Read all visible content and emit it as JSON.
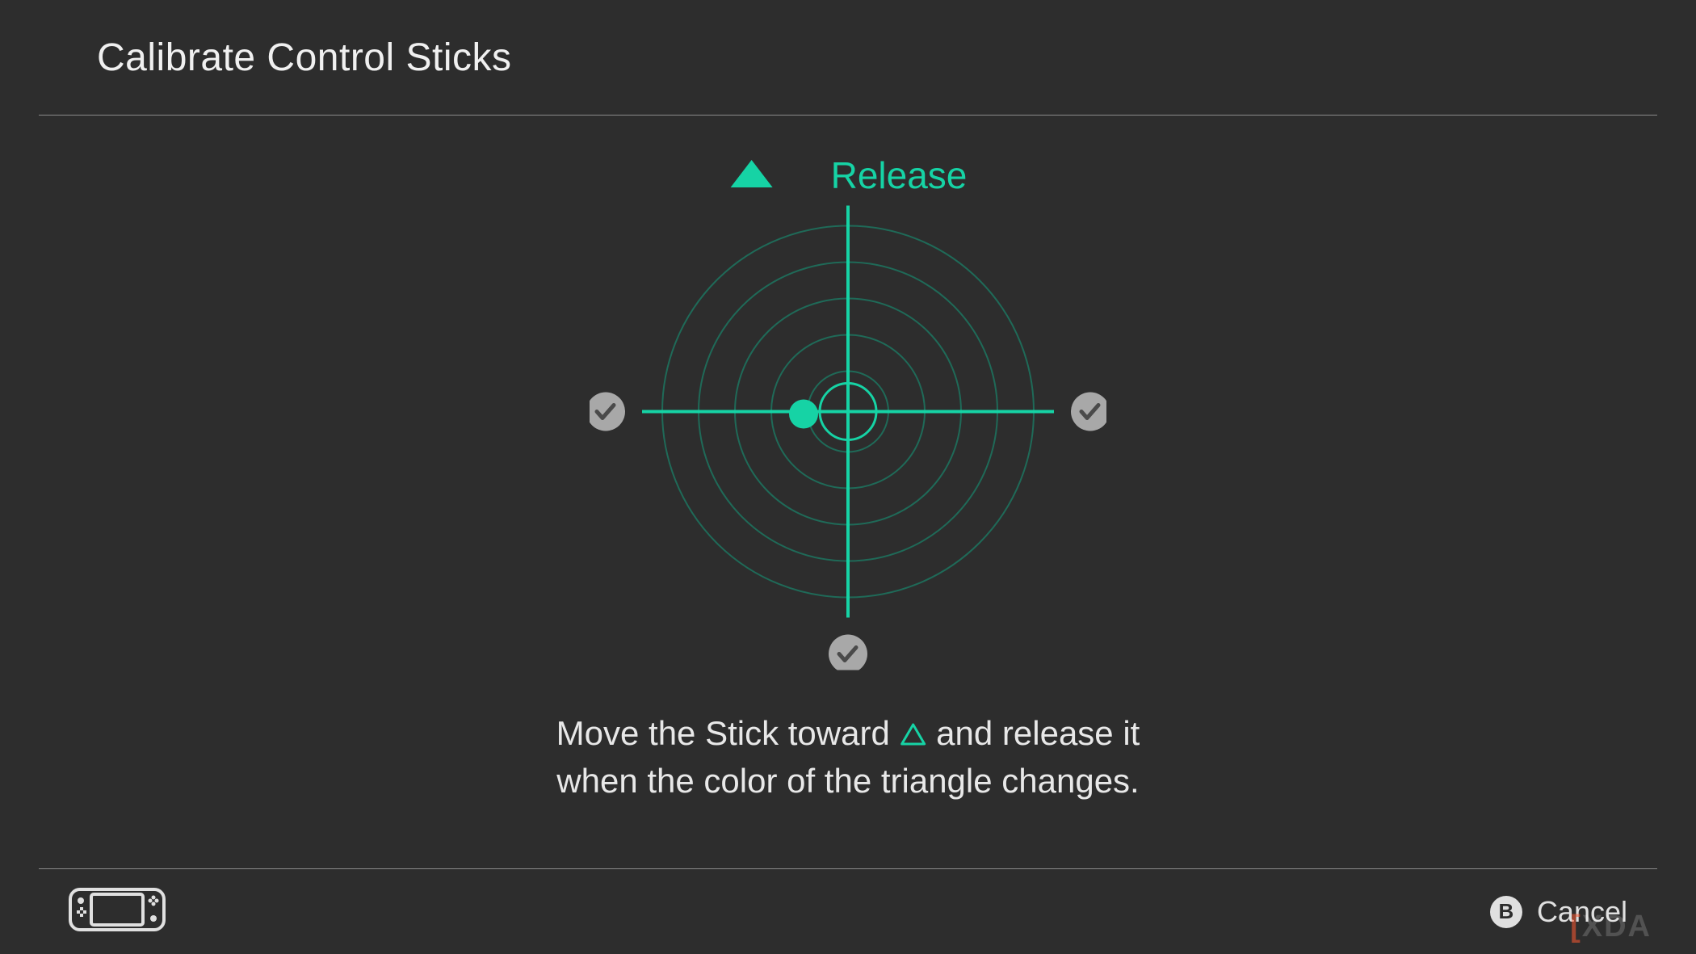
{
  "colors": {
    "accent": "#16d3a5",
    "bg": "#2d2d2d",
    "fg": "#f0f0f0",
    "muted": "#9e9e9e",
    "check_bg": "#a8a8a8",
    "check_fg": "#4a4a4a"
  },
  "header": {
    "title": "Calibrate Control Sticks"
  },
  "calibration": {
    "release_label": "Release",
    "active_direction": "up",
    "directions": {
      "up": {
        "status": "active"
      },
      "right": {
        "status": "done"
      },
      "down": {
        "status": "done"
      },
      "left": {
        "status": "done"
      }
    },
    "stick_position": {
      "x": -0.22,
      "y": 0.0
    }
  },
  "instruction": {
    "line1_pre": "Move the Stick toward ",
    "line1_post": " and release it",
    "line2": "when the color of the triangle changes."
  },
  "footer": {
    "cancel_button_glyph": "B",
    "cancel_label": "Cancel"
  },
  "watermark": "XDA"
}
